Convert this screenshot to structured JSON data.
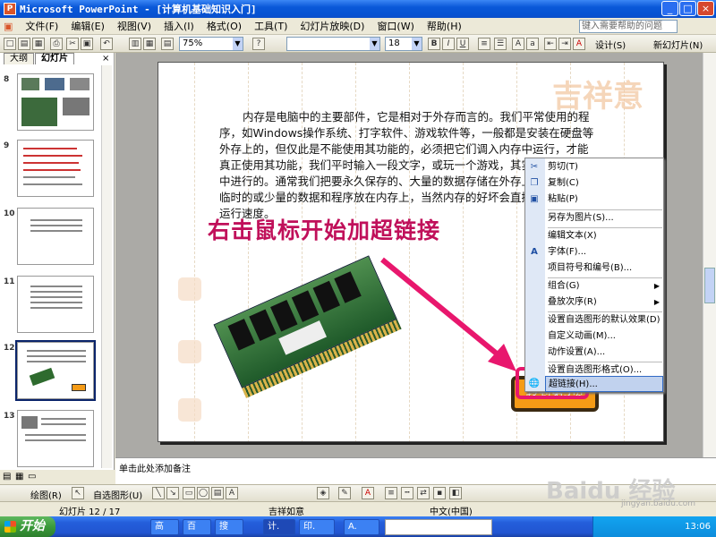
{
  "window": {
    "title": "Microsoft PowerPoint - [计算机基础知识入门]",
    "app_icon": "P",
    "controls": [
      "_",
      "□",
      "×"
    ]
  },
  "menubar": {
    "items": [
      "文件(F)",
      "编辑(E)",
      "视图(V)",
      "插入(I)",
      "格式(O)",
      "工具(T)",
      "幻灯片放映(D)",
      "窗口(W)",
      "帮助(H)"
    ],
    "help_placeholder": "键入需要帮助的问题"
  },
  "toolbar": {
    "zoom": "75%",
    "font_size": "18",
    "design_label": "设计(S)",
    "new_slide_label": "新幻灯片(N)"
  },
  "left_pane": {
    "tabs": [
      "大纲",
      "幻灯片"
    ],
    "thumbnails": [
      {
        "num": "8"
      },
      {
        "num": "9"
      },
      {
        "num": "10"
      },
      {
        "num": "11"
      },
      {
        "num": "12",
        "selected": true
      },
      {
        "num": "13"
      }
    ]
  },
  "slide": {
    "body_text": "内存是电脑中的主要部件，它是相对于外存而言的。我们平常使用的程序，如Windows操作系统、打字软件、游戏软件等，一般都是安装在硬盘等外存上的，但仅此是不能使用其功能的，必须把它们调入内存中运行，才能真正使用其功能，我们平时输入一段文字，或玩一个游戏，其实都是在内存中进行的。通常我们把要永久保存的、大量的数据存储在外存上，而把一些临时的或少量的数据和程序放在内存上，当然内存的好坏会直接影响电脑的运行速度。",
    "overlay_caption": "右击鼠标开始加超链接",
    "decor_word": "吉祥意",
    "goto_button_label": "转到第5页"
  },
  "context_menu": {
    "items": [
      {
        "label": "剪切(T)",
        "icon": "scissors-icon"
      },
      {
        "label": "复制(C)",
        "icon": "copy-icon"
      },
      {
        "label": "粘贴(P)",
        "icon": "paste-icon"
      },
      {
        "label": "另存为图片(S)...",
        "sep_before": true
      },
      {
        "label": "编辑文本(X)",
        "sep_before": true
      },
      {
        "label": "字体(F)...",
        "icon": "font-icon"
      },
      {
        "label": "项目符号和编号(B)..."
      },
      {
        "label": "组合(G)",
        "submenu": true,
        "sep_before": true
      },
      {
        "label": "叠放次序(R)",
        "submenu": true
      },
      {
        "label": "设置自选图形的默认效果(D)",
        "sep_before": true
      },
      {
        "label": "自定义动画(M)..."
      },
      {
        "label": "动作设置(A)..."
      },
      {
        "label": "设置自选图形格式(O)...",
        "sep_before": true
      },
      {
        "label": "超链接(H)...",
        "icon": "hyperlink-icon",
        "highlighted": true
      }
    ]
  },
  "notes": {
    "placeholder": "单击此处添加备注"
  },
  "drawbar": {
    "draw_label": "绘图(R)",
    "autoshape_label": "自选图形(U)"
  },
  "statusbar": {
    "slide_info": "幻灯片 12 / 17",
    "template": "吉祥如意",
    "language": "中文(中国)"
  },
  "taskbar": {
    "start_label": "开始",
    "tasks": [
      "高",
      "百",
      "搜",
      "计.",
      "印.",
      "A."
    ],
    "clock": "13:06"
  },
  "watermark": {
    "brand": "Baidu 经验",
    "url": "jingyan.baidu.com"
  }
}
